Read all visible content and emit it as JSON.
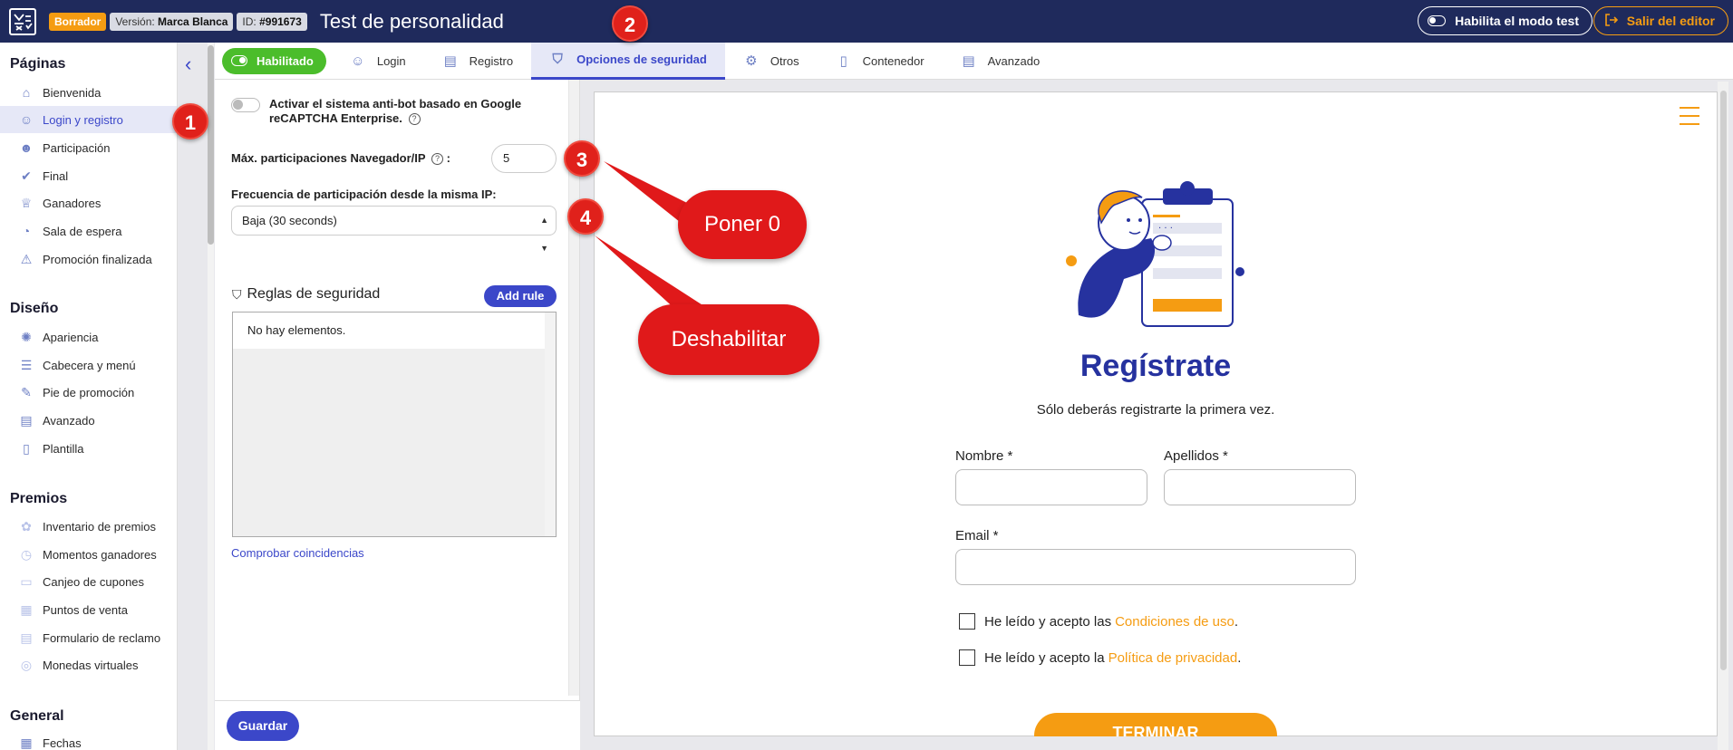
{
  "header": {
    "status_badge": "Borrador",
    "version_label": "Versión:",
    "version_value": "Marca Blanca",
    "id_label": "ID:",
    "id_value": "#991673",
    "title": "Test de personalidad",
    "test_mode_label": "Habilita el modo test",
    "exit_label": "Salir del editor"
  },
  "sidebar": {
    "sections": [
      {
        "title": "Páginas",
        "items": [
          {
            "label": "Bienvenida",
            "icon": "home-icon"
          },
          {
            "label": "Login y registro",
            "icon": "user-icon",
            "active": true
          },
          {
            "label": "Participación",
            "icon": "participation-icon"
          },
          {
            "label": "Final",
            "icon": "check-icon"
          },
          {
            "label": "Ganadores",
            "icon": "trophy-icon"
          },
          {
            "label": "Sala de espera",
            "icon": "gauge-icon"
          },
          {
            "label": "Promoción finalizada",
            "icon": "warning-icon"
          }
        ]
      },
      {
        "title": "Diseño",
        "items": [
          {
            "label": "Apariencia",
            "icon": "palette-icon"
          },
          {
            "label": "Cabecera y menú",
            "icon": "menu-icon"
          },
          {
            "label": "Pie de promoción",
            "icon": "brush-icon"
          },
          {
            "label": "Avanzado",
            "icon": "code-icon"
          },
          {
            "label": "Plantilla",
            "icon": "file-icon"
          }
        ]
      },
      {
        "title": "Premios",
        "items": [
          {
            "label": "Inventario de premios",
            "icon": "gift-icon"
          },
          {
            "label": "Momentos ganadores",
            "icon": "clock-icon"
          },
          {
            "label": "Canjeo de cupones",
            "icon": "coupon-icon"
          },
          {
            "label": "Puntos de venta",
            "icon": "store-icon"
          },
          {
            "label": "Formulario de reclamo",
            "icon": "form-icon"
          },
          {
            "label": "Monedas virtuales",
            "icon": "coins-icon"
          }
        ]
      },
      {
        "title": "General",
        "items": [
          {
            "label": "Fechas",
            "icon": "calendar-icon"
          }
        ]
      }
    ]
  },
  "tabs": {
    "enabled_label": "Habilitado",
    "items": [
      {
        "label": "Login",
        "icon": "user-icon"
      },
      {
        "label": "Registro",
        "icon": "form-icon"
      },
      {
        "label": "Opciones de seguridad",
        "icon": "shield-icon",
        "active": true
      },
      {
        "label": "Otros",
        "icon": "gear-icon"
      },
      {
        "label": "Contenedor",
        "icon": "file-icon"
      },
      {
        "label": "Avanzado",
        "icon": "code-icon"
      }
    ]
  },
  "security": {
    "antibot_label_1": "Activar el sistema anti-bot basado en Google",
    "antibot_label_2": "reCAPTCHA Enterprise.",
    "max_label": "Máx. participaciones Navegador/IP",
    "max_colon": ":",
    "max_value": "5",
    "freq_label": "Frecuencia de participación desde la misma IP:",
    "freq_value": "Baja (30 seconds)",
    "rules_title": "Reglas de seguridad",
    "add_rule": "Add rule",
    "empty_text": "No hay elementos.",
    "check_link": "Comprobar coincidencias",
    "save_label": "Guardar"
  },
  "preview": {
    "title": "Regístrate",
    "subtitle": "Sólo deberás registrarte la primera vez.",
    "name_label": "Nombre *",
    "surname_label": "Apellidos *",
    "email_label": "Email *",
    "terms_prefix": "He leído y acepto las",
    "terms_link": "Condiciones de uso",
    "privacy_prefix": "He leído y acepto la",
    "privacy_link": "Política de privacidad",
    "period": ".",
    "finish_label": "TERMINAR"
  },
  "annotations": {
    "n1": "1",
    "n2": "2",
    "n3": "3",
    "n4": "4",
    "callout_1": "Poner 0",
    "callout_2": "Deshabilitar"
  },
  "colors": {
    "header_bg": "#1f2a5c",
    "accent": "#3b47c9",
    "brand_orange": "#f59c12",
    "enabled_green": "#4bbd2b",
    "annotation_red": "#e0211b"
  }
}
